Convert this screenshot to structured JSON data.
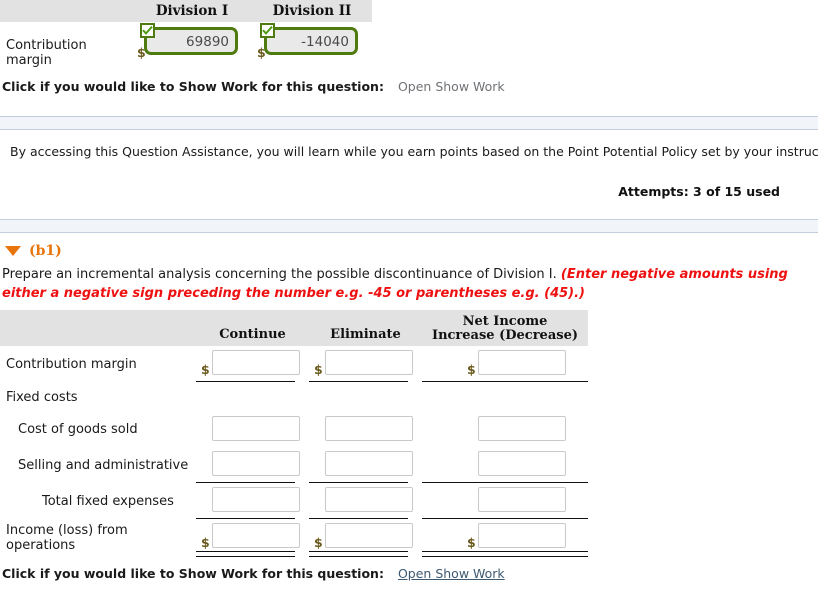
{
  "part_a": {
    "column_headers": [
      "Division I",
      "Division II"
    ],
    "rows": [
      {
        "label": "Contribution margin",
        "currency_symbol": "$",
        "cells": [
          {
            "value": "69890",
            "status": "correct",
            "status_icon": "check-icon"
          },
          {
            "value": "-14040",
            "status": "correct",
            "status_icon": "check-icon"
          }
        ]
      }
    ]
  },
  "show_work_top": {
    "prompt": "Click if you would like to Show Work for this question:",
    "link_label": "Open Show Work"
  },
  "question_assistance": {
    "text": "By accessing this Question Assistance, you will learn while you earn points based on the Point Potential Policy set by your instructor.",
    "attempts": "Attempts: 3 of 15 used"
  },
  "part_b1": {
    "disclosure_icon": "triangle-down-icon",
    "label": "(b1)",
    "label_color": "#e8740c",
    "instruction_plain": "Prepare an incremental analysis concerning the possible discontinuance of Division I. ",
    "instruction_emphasis": "(Enter negative amounts using either a negative sign preceding the number e.g. -45 or parentheses e.g. (45).)",
    "instruction_emphasis_color": "#ee1111",
    "table": {
      "column_headers": [
        "Continue",
        "Eliminate",
        "Net Income Increase (Decrease)"
      ],
      "column_headers_lines": [
        [
          "Continue"
        ],
        [
          "Eliminate"
        ],
        [
          "Net Income",
          "Increase (Decrease)"
        ]
      ],
      "rows": [
        {
          "label": "Contribution margin",
          "indent": 0,
          "currency_symbol": "$",
          "has_currency": true,
          "values": [
            "",
            "",
            ""
          ],
          "rule_bottom": "single"
        },
        {
          "label": "Fixed costs",
          "indent": 0,
          "has_currency": false,
          "values": [],
          "is_section": true
        },
        {
          "label": "Cost of goods sold",
          "indent": 1,
          "has_currency": false,
          "values": [
            "",
            "",
            ""
          ],
          "rule_bottom": "none"
        },
        {
          "label": "Selling and administrative",
          "indent": 1,
          "has_currency": false,
          "values": [
            "",
            "",
            ""
          ],
          "rule_bottom": "single"
        },
        {
          "label": "Total fixed expenses",
          "indent": 2,
          "has_currency": false,
          "values": [
            "",
            "",
            ""
          ],
          "rule_bottom": "single"
        },
        {
          "label": "Income (loss) from operations",
          "indent": 0,
          "currency_symbol": "$",
          "has_currency": true,
          "values": [
            "",
            "",
            ""
          ],
          "rule_bottom": "double"
        }
      ]
    }
  },
  "show_work_bottom": {
    "prompt": "Click if you would like to Show Work for this question:",
    "link_label": "Open Show Work"
  }
}
